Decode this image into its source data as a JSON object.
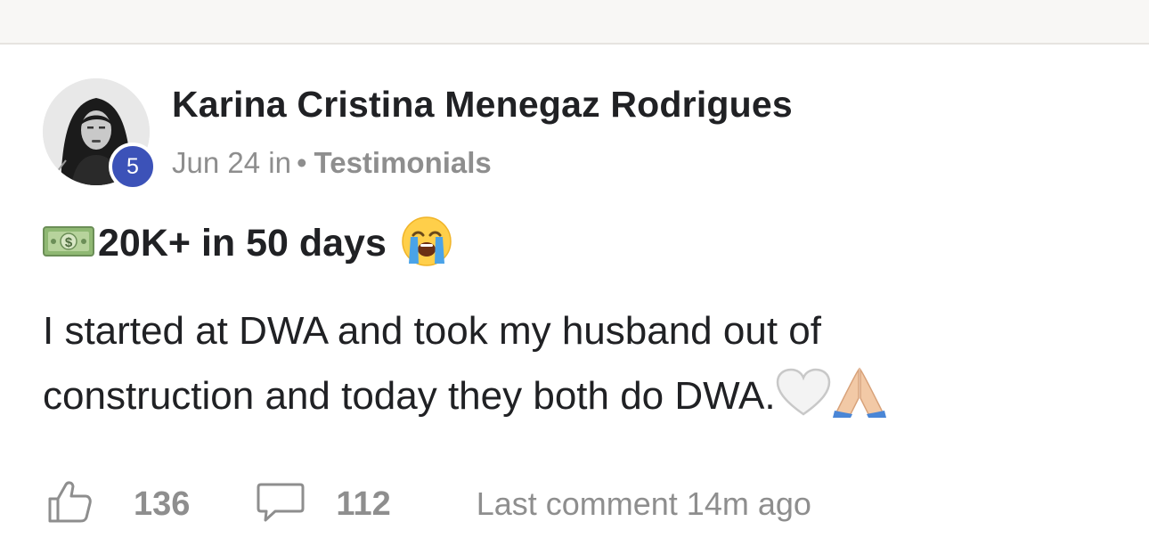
{
  "post": {
    "author": "Karina Cristina Menegaz Rodrigues",
    "level": "5",
    "date": "Jun 24",
    "in_word": "in",
    "separator": "•",
    "category": "Testimonials",
    "title": "20K+ in 50 days",
    "title_icons": [
      "money-bill-icon",
      "loudly-crying-face-icon"
    ],
    "body_text": "I started at DWA and took my husband out of construction and today they both do DWA.",
    "body_icons": [
      "white-heart-icon",
      "folded-hands-icon"
    ]
  },
  "footer": {
    "likes": "136",
    "comments": "112",
    "last_comment": "Last comment 14m ago",
    "icons": [
      "thumbs-up-icon",
      "comment-icon"
    ]
  },
  "colors": {
    "badge": "#3c52b8",
    "muted": "#8e8e8e",
    "text": "#202124",
    "top_strip": "#f8f7f5"
  }
}
